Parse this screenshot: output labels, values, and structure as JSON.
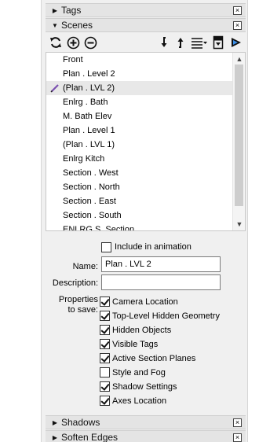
{
  "panels": {
    "tags": {
      "title": "Tags",
      "state": "collapsed"
    },
    "scenes": {
      "title": "Scenes",
      "state": "expanded"
    },
    "shadows": {
      "title": "Shadows",
      "state": "collapsed"
    },
    "soften_edges": {
      "title": "Soften Edges",
      "state": "collapsed"
    }
  },
  "icons": {
    "collapsed_triangle": "▶",
    "expanded_triangle": "▼",
    "close": "×"
  },
  "scenes": {
    "selected_index": 2,
    "items": [
      {
        "label": "Front"
      },
      {
        "label": "Plan . Level 2"
      },
      {
        "label": "(Plan . LVL 2)"
      },
      {
        "label": "Enlrg . Bath"
      },
      {
        "label": "M. Bath Elev"
      },
      {
        "label": "Plan . Level 1"
      },
      {
        "label": "(Plan . LVL 1)"
      },
      {
        "label": "Enlrg Kitch"
      },
      {
        "label": "Section . West"
      },
      {
        "label": "Section . North"
      },
      {
        "label": "Section . East"
      },
      {
        "label": "Section . South"
      },
      {
        "label": "ENLRG S. Section"
      }
    ]
  },
  "properties": {
    "include_in_animation": {
      "label": "Include in animation",
      "checked": false
    },
    "name_label": "Name:",
    "name_value": "Plan . LVL 2",
    "description_label": "Description:",
    "description_value": "",
    "properties_label_line1": "Properties",
    "properties_label_line2": "to save:",
    "save_options": [
      {
        "label": "Camera Location",
        "checked": true
      },
      {
        "label": "Top-Level Hidden Geometry",
        "checked": true
      },
      {
        "label": "Hidden Objects",
        "checked": true
      },
      {
        "label": "Visible Tags",
        "checked": true
      },
      {
        "label": "Active Section Planes",
        "checked": true
      },
      {
        "label": "Style and Fog",
        "checked": false
      },
      {
        "label": "Shadow Settings",
        "checked": true
      },
      {
        "label": "Axes Location",
        "checked": true
      }
    ]
  }
}
